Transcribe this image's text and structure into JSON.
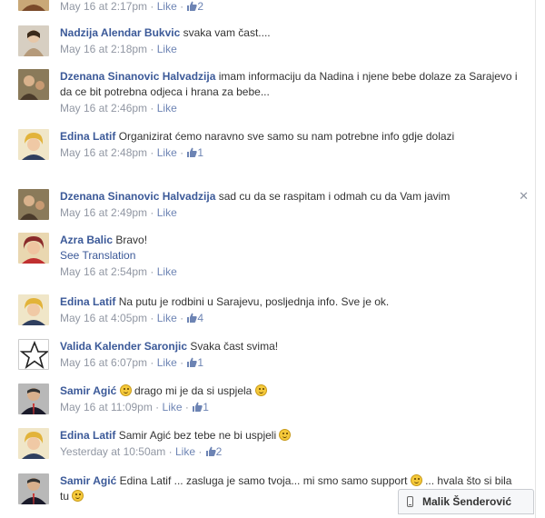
{
  "comments": [
    {
      "name": "",
      "text": "",
      "meta_time": "May 16 at 2:17pm",
      "like": "Like",
      "likes": "2"
    },
    {
      "name": "Nadzija Alendar Bukvic",
      "text": "svaka vam čast....",
      "meta_time": "May 16 at 2:18pm",
      "like": "Like"
    },
    {
      "name": "Dzenana Sinanovic Halvadzija",
      "text": "imam informaciju da Nadina i njene bebe dolaze za Sarajevo i da ce bit potrebna odjeca i hrana za bebe...",
      "meta_time": "May 16 at 2:46pm",
      "like": "Like"
    },
    {
      "name": "Edina Latif",
      "text": "Organizirat ćemo naravno sve samo su nam potrebne info gdje dolazi",
      "meta_time": "May 16 at 2:48pm",
      "like": "Like",
      "likes": "1"
    },
    {
      "name": "Dzenana Sinanovic Halvadzija",
      "text": "sad cu da se raspitam i odmah cu da Vam javim",
      "meta_time": "May 16 at 2:49pm",
      "like": "Like"
    },
    {
      "name": "Azra Balic",
      "text": "Bravo!",
      "see_translation": "See Translation",
      "meta_time": "May 16 at 2:54pm",
      "like": "Like"
    },
    {
      "name": "Edina Latif",
      "text": "Na putu je rodbini u Sarajevu, posljednja info. Sve je ok.",
      "meta_time": "May 16 at 4:05pm",
      "like": "Like",
      "likes": "4"
    },
    {
      "name": "Valida Kalender Saronjic",
      "text": "Svaka čast svima!",
      "meta_time": "May 16 at 6:07pm",
      "like": "Like",
      "likes": "1"
    },
    {
      "name": "Samir Agić",
      "text_a": "drago mi je da si uspjela",
      "meta_time": "May 16 at 11:09pm",
      "like": "Like",
      "likes": "1"
    },
    {
      "name": "Edina Latif",
      "text": "Samir Agić bez tebe ne bi uspjeli",
      "meta_time": "Yesterday at 10:50am",
      "like": "Like",
      "likes": "2"
    },
    {
      "name": "Samir Agić",
      "text_a": "Edina Latif ... zasluga je samo tvoja... mi smo samo support",
      "text_b": "... hvala što si bila tu"
    }
  ],
  "chat": {
    "name": "Malik Šenderović"
  },
  "colors": {
    "link": "#3b5998",
    "meta": "#9197a3",
    "like": "#6d84b4"
  }
}
